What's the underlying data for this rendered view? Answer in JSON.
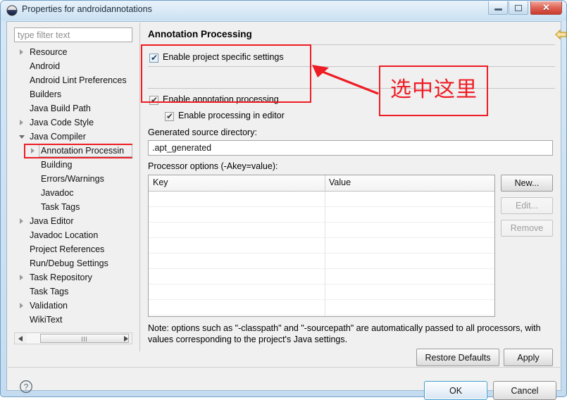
{
  "window": {
    "title": "Properties for androidannotations",
    "icon": "eclipse-globe-icon",
    "minimize_label": "Minimize",
    "maximize_label": "Maximize",
    "close_label": "Close"
  },
  "filter": {
    "placeholder": "type filter text",
    "value": ""
  },
  "tree": {
    "items": [
      {
        "label": "Resource",
        "indent": 0,
        "arrow": "collapsed",
        "selected": false
      },
      {
        "label": "Android",
        "indent": 0,
        "arrow": "none",
        "selected": false
      },
      {
        "label": "Android Lint Preferences",
        "indent": 0,
        "arrow": "none",
        "selected": false
      },
      {
        "label": "Builders",
        "indent": 0,
        "arrow": "none",
        "selected": false
      },
      {
        "label": "Java Build Path",
        "indent": 0,
        "arrow": "none",
        "selected": false
      },
      {
        "label": "Java Code Style",
        "indent": 0,
        "arrow": "collapsed",
        "selected": false
      },
      {
        "label": "Java Compiler",
        "indent": 0,
        "arrow": "expanded",
        "selected": false
      },
      {
        "label": "Annotation Processin",
        "indent": 1,
        "arrow": "collapsed",
        "selected": true
      },
      {
        "label": "Building",
        "indent": 1,
        "arrow": "none",
        "selected": false
      },
      {
        "label": "Errors/Warnings",
        "indent": 1,
        "arrow": "none",
        "selected": false
      },
      {
        "label": "Javadoc",
        "indent": 1,
        "arrow": "none",
        "selected": false
      },
      {
        "label": "Task Tags",
        "indent": 1,
        "arrow": "none",
        "selected": false
      },
      {
        "label": "Java Editor",
        "indent": 0,
        "arrow": "collapsed",
        "selected": false
      },
      {
        "label": "Javadoc Location",
        "indent": 0,
        "arrow": "none",
        "selected": false
      },
      {
        "label": "Project References",
        "indent": 0,
        "arrow": "none",
        "selected": false
      },
      {
        "label": "Run/Debug Settings",
        "indent": 0,
        "arrow": "none",
        "selected": false
      },
      {
        "label": "Task Repository",
        "indent": 0,
        "arrow": "collapsed",
        "selected": false
      },
      {
        "label": "Task Tags",
        "indent": 0,
        "arrow": "none",
        "selected": false
      },
      {
        "label": "Validation",
        "indent": 0,
        "arrow": "collapsed",
        "selected": false
      },
      {
        "label": "WikiText",
        "indent": 0,
        "arrow": "none",
        "selected": false
      }
    ],
    "hscroll": {
      "left_arrow": "scroll-left",
      "right_arrow": "scroll-right"
    }
  },
  "page": {
    "title": "Annotation Processing",
    "nav": {
      "back_icon": "back-arrow-icon",
      "back_menu_icon": "chevron-down-icon",
      "forward_icon": "forward-arrow-icon",
      "forward_menu_icon": "chevron-down-icon",
      "menu_icon": "chevron-down-icon"
    },
    "checkboxes": [
      {
        "label": "Enable project specific settings",
        "checked": true,
        "style": "focused"
      },
      {
        "label": "Enable annotation processing",
        "checked": true,
        "style": "gray"
      },
      {
        "label": "Enable processing in editor",
        "checked": true,
        "style": "gray"
      }
    ],
    "generated_source": {
      "label": "Generated source directory:",
      "value": ".apt_generated"
    },
    "processor_options": {
      "label": "Processor options (-Akey=value):",
      "columns": [
        "Key",
        "Value"
      ],
      "rows": [],
      "empty_row_count": 8,
      "buttons": [
        {
          "label": "New...",
          "enabled": true
        },
        {
          "label": "Edit...",
          "enabled": false
        },
        {
          "label": "Remove",
          "enabled": false
        }
      ]
    },
    "note": "Note: options such as \"-classpath\" and \"-sourcepath\" are automatically passed to all processors, with values corresponding to the project's Java settings.",
    "restore_defaults_label": "Restore Defaults",
    "apply_label": "Apply"
  },
  "footer": {
    "help_icon": "help-question-icon",
    "ok_label": "OK",
    "cancel_label": "Cancel"
  },
  "annotation": {
    "text": "选中这里",
    "color": "#ee1c24",
    "arrow_icon": "pointer-arrow-icon"
  },
  "colors": {
    "accent": "#3f9ccf",
    "annotation_red": "#ee1c24",
    "dialog_bg": "#f0f0f0",
    "titlebar_top": "#e9f2fa",
    "close_button": "#c93a2a"
  }
}
